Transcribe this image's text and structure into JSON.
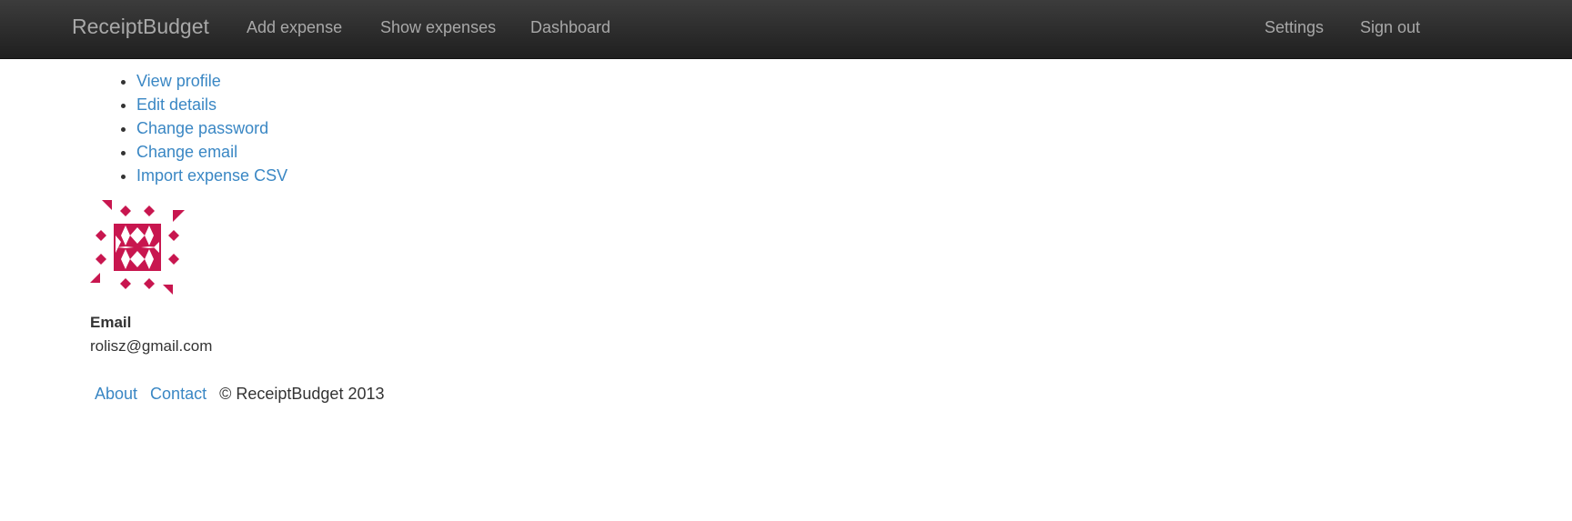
{
  "navbar": {
    "brand": "ReceiptBudget",
    "left_links": [
      {
        "label": "Add expense"
      },
      {
        "label": "Show expenses"
      },
      {
        "label": "Dashboard"
      }
    ],
    "right_links": [
      {
        "label": "Settings"
      },
      {
        "label": "Sign out"
      }
    ]
  },
  "menu": {
    "items": [
      {
        "label": "View profile"
      },
      {
        "label": "Edit details"
      },
      {
        "label": "Change password"
      },
      {
        "label": "Change email"
      },
      {
        "label": "Import expense CSV"
      }
    ]
  },
  "profile": {
    "avatar_color": "#c8164f",
    "email_label": "Email",
    "email_value": "rolisz@gmail.com"
  },
  "footer": {
    "about": "About",
    "contact": "Contact",
    "copyright": "© ReceiptBudget 2013"
  },
  "colors": {
    "link": "#3a87c4",
    "navbar_text": "#a8a8a8",
    "navbar_bg": "#2a2a2a"
  }
}
